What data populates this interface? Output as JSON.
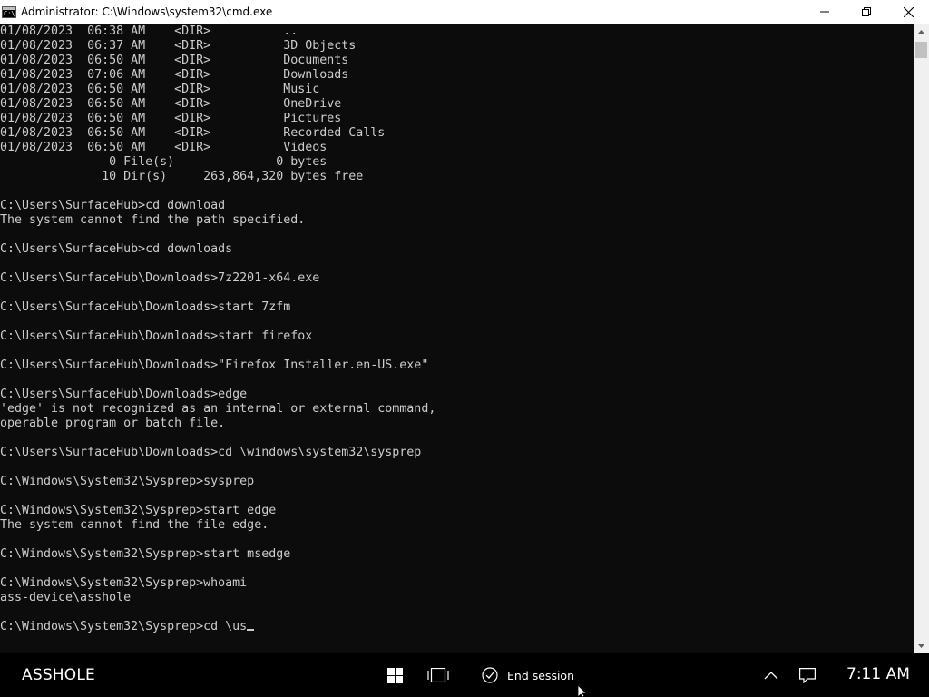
{
  "window": {
    "title": "Administrator: C:\\Windows\\system32\\cmd.exe",
    "icon_text": "C:\\",
    "buttons": [
      "minimize-icon",
      "maximize-icon",
      "close-icon"
    ]
  },
  "console": {
    "lines": [
      "01/08/2023  06:38 AM    <DIR>          ..",
      "01/08/2023  06:37 AM    <DIR>          3D Objects",
      "01/08/2023  06:50 AM    <DIR>          Documents",
      "01/08/2023  07:06 AM    <DIR>          Downloads",
      "01/08/2023  06:50 AM    <DIR>          Music",
      "01/08/2023  06:50 AM    <DIR>          OneDrive",
      "01/08/2023  06:50 AM    <DIR>          Pictures",
      "01/08/2023  06:50 AM    <DIR>          Recorded Calls",
      "01/08/2023  06:50 AM    <DIR>          Videos",
      "               0 File(s)              0 bytes",
      "              10 Dir(s)     263,864,320 bytes free",
      "",
      "C:\\Users\\SurfaceHub>cd download",
      "The system cannot find the path specified.",
      "",
      "C:\\Users\\SurfaceHub>cd downloads",
      "",
      "C:\\Users\\SurfaceHub\\Downloads>7z2201-x64.exe",
      "",
      "C:\\Users\\SurfaceHub\\Downloads>start 7zfm",
      "",
      "C:\\Users\\SurfaceHub\\Downloads>start firefox",
      "",
      "C:\\Users\\SurfaceHub\\Downloads>\"Firefox Installer.en-US.exe\"",
      "",
      "C:\\Users\\SurfaceHub\\Downloads>edge",
      "'edge' is not recognized as an internal or external command,",
      "operable program or batch file.",
      "",
      "C:\\Users\\SurfaceHub\\Downloads>cd \\windows\\system32\\sysprep",
      "",
      "C:\\Windows\\System32\\Sysprep>sysprep",
      "",
      "C:\\Windows\\System32\\Sysprep>start edge",
      "The system cannot find the file edge.",
      "",
      "C:\\Windows\\System32\\Sysprep>start msedge",
      "",
      "C:\\Windows\\System32\\Sysprep>whoami",
      "ass-device\\asshole",
      "",
      "C:\\Windows\\System32\\Sysprep>cd \\us"
    ],
    "foreground": "#cccccc",
    "background": "#0c0c0c"
  },
  "taskbar": {
    "device_name": "ASSHOLE",
    "icons": [
      "start-windows-icon",
      "task-view-icon"
    ],
    "end_session_label": "End session",
    "notification_icons": [
      "chevron-up-icon",
      "action-center-icon"
    ],
    "clock": "7:11 AM"
  }
}
